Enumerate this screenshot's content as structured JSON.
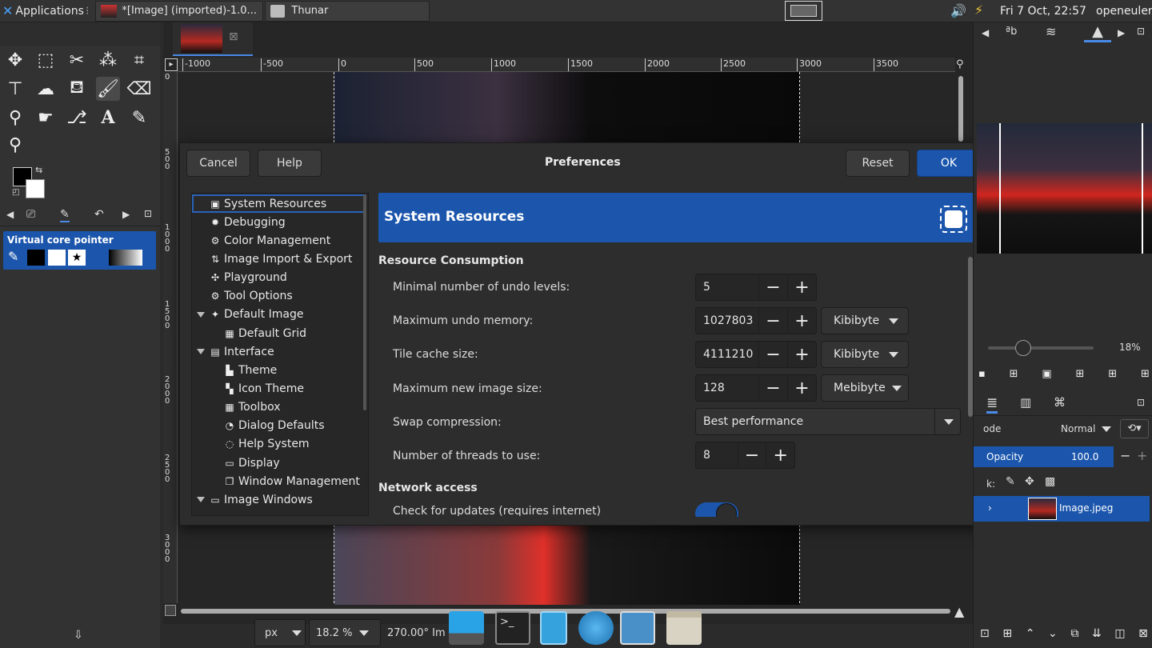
{
  "topbar": {
    "apps_label": "Applications",
    "apps_sep": "⁝",
    "task1": "*[Image] (imported)-1.0...",
    "task2": "Thunar",
    "clock": "Fri  7 Oct, 22:57",
    "user": "openeuler"
  },
  "toolbox": {
    "pointer_title": "Virtual core pointer"
  },
  "ruler": {
    "h_ticks": [
      "-1000",
      "-500",
      "0",
      "500",
      "1000",
      "1500",
      "2000",
      "2500",
      "3000",
      "3500"
    ],
    "v_ticks": [
      "0",
      "500",
      "1000",
      "1500",
      "2000",
      "2500",
      "3000"
    ]
  },
  "dialog": {
    "title": "Preferences",
    "cancel": "Cancel",
    "help": "Help",
    "reset": "Reset",
    "ok": "OK",
    "nav": [
      {
        "label": "System Resources",
        "icon": "chip"
      },
      {
        "label": "Debugging",
        "icon": "bug"
      },
      {
        "label": "Color Management",
        "icon": "color"
      },
      {
        "label": "Image Import & Export",
        "icon": "import"
      },
      {
        "label": "Playground",
        "icon": "pinwheel"
      },
      {
        "label": "Tool Options",
        "icon": "tooloptions"
      },
      {
        "label": "Default Image",
        "icon": "image"
      },
      {
        "label": "Default Grid",
        "icon": "grid"
      },
      {
        "label": "Interface",
        "icon": "interface"
      },
      {
        "label": "Theme",
        "icon": "theme"
      },
      {
        "label": "Icon Theme",
        "icon": "icontheme"
      },
      {
        "label": "Toolbox",
        "icon": "toolbox"
      },
      {
        "label": "Dialog Defaults",
        "icon": "dialog"
      },
      {
        "label": "Help System",
        "icon": "help"
      },
      {
        "label": "Display",
        "icon": "display"
      },
      {
        "label": "Window Management",
        "icon": "windows"
      },
      {
        "label": "Image Windows",
        "icon": "imagewin"
      }
    ],
    "banner_title": "System Resources",
    "section1": "Resource Consumption",
    "undo_levels_label": "Minimal number of undo levels:",
    "undo_levels_value": "5",
    "undo_memory_label": "Maximum undo memory:",
    "undo_memory_value": "1027803",
    "undo_memory_unit": "Kibibyte",
    "tile_cache_label": "Tile cache size:",
    "tile_cache_value": "4111210",
    "tile_cache_unit": "Kibibyte",
    "max_image_label": "Maximum new image size:",
    "max_image_value": "128",
    "max_image_unit": "Mebibyte",
    "swap_label": "Swap compression:",
    "swap_value": "Best performance",
    "threads_label": "Number of threads to use:",
    "threads_value": "8",
    "section2": "Network access",
    "updates_label": "Check for updates (requires internet)",
    "updates_on": true
  },
  "rdock": {
    "zoom_pct": "18%",
    "mode_label": "ode",
    "mode_value": "Normal",
    "opacity_label": "Opacity",
    "opacity_value": "100.0",
    "lock_label": "k:",
    "layer_name": "Image.jpeg"
  },
  "statusbar": {
    "unit": "px",
    "zoom": "18.2 %",
    "rotation": "270.00° Im"
  },
  "colors": {
    "accent": "#1b56ac",
    "selected": "#2a62b8",
    "bg": "#2b2b2b"
  }
}
